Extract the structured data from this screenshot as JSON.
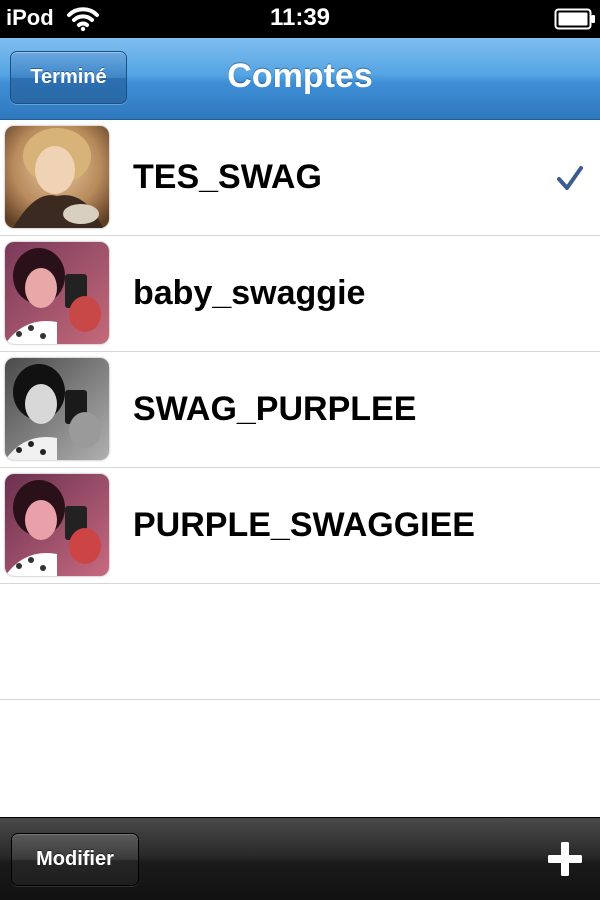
{
  "status_bar": {
    "carrier": "iPod",
    "time": "11:39",
    "wifi_icon": "wifi-icon",
    "battery_icon": "battery-icon"
  },
  "nav_bar": {
    "title": "Comptes",
    "done_label": "Terminé"
  },
  "accounts": [
    {
      "name": "TES_SWAG",
      "selected": true,
      "avatar": "avatar-photo"
    },
    {
      "name": "baby_swaggie",
      "selected": false,
      "avatar": "avatar-photo"
    },
    {
      "name": "SWAG_PURPLEE",
      "selected": false,
      "avatar": "avatar-photo"
    },
    {
      "name": "PURPLE_SWAGGIEE",
      "selected": false,
      "avatar": "avatar-photo"
    }
  ],
  "toolbar": {
    "modify_label": "Modifier",
    "add_icon": "plus-icon"
  },
  "colors": {
    "nav_blue": "#3f8fd6",
    "checkmark": "#3a5c8f",
    "toolbar_dark": "#1a1a1a"
  }
}
